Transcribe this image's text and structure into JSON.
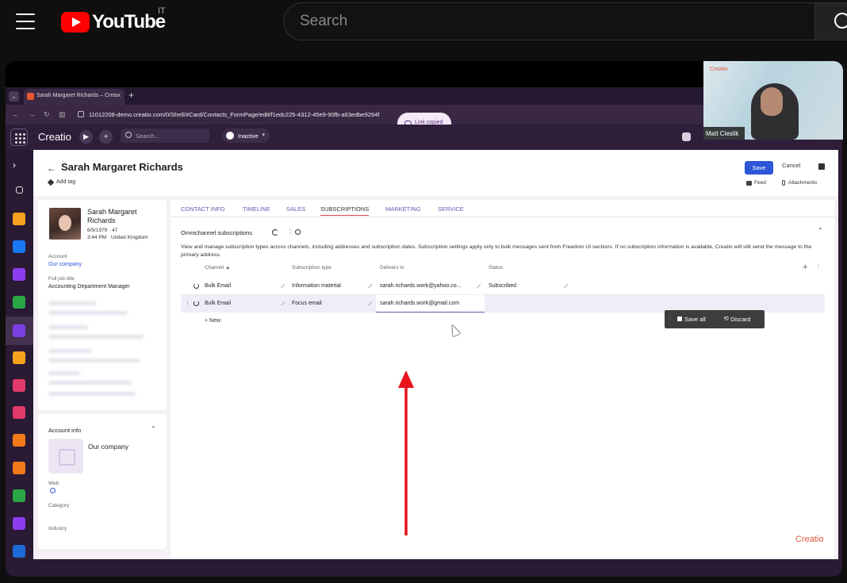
{
  "youtube": {
    "logo_text": "YouTube",
    "country_code": "IT",
    "search_placeholder": "Search"
  },
  "browser": {
    "tab_title": "Sarah Margaret Richards – Crea",
    "url": "11012208-demo.creatio.com/0/Shell/#Card/Contacts_FormPage/edit/f1edc225-4312-45e9-90fb-a63edbe9294f",
    "toast": "Link copied"
  },
  "creatio_bar": {
    "logo": "Creatio",
    "search_placeholder": "Search...",
    "status": "Inactive"
  },
  "header": {
    "title": "Sarah Margaret Richards",
    "add_tag": "Add tag",
    "save": "Save",
    "cancel": "Cancel",
    "feed": "Feed",
    "attachments": "Attachments"
  },
  "contact": {
    "name": "Sarah Margaret Richards",
    "dob": "6/5/1979 · 47",
    "time_location": "3:44 PM · United Kingdom",
    "account_label": "Account",
    "account_value": "Our company",
    "job_label": "Full job title",
    "job_value": "Accounting Department Manager"
  },
  "account_info": {
    "title": "Account info",
    "company": "Our company",
    "web_label": "Web",
    "category_label": "Category",
    "industry_label": "Industry"
  },
  "tabs": [
    "CONTACT INFO",
    "TIMELINE",
    "SALES",
    "SUBSCRIPTIONS",
    "MARKETING",
    "SERVICE"
  ],
  "subscriptions": {
    "title": "Omnichannel subscriptions",
    "description": "View and manage subscription types across channels, including addresses and subscription dates. Subscription settings apply only to bulk messages sent from Freedom UI sections. If no subscription information is available, Creatio will still send the message to the primary address.",
    "columns": [
      "Channel",
      "Subscription type",
      "Delivers to",
      "Status"
    ],
    "rows": [
      {
        "channel": "Bulk Email",
        "type": "Information material",
        "delivers_to": "sarah.richards.work@yahoo.co...",
        "status": "Subscribed"
      },
      {
        "channel": "Bulk Email",
        "type": "Focus email",
        "delivers_to": "sarah.richards.work@gmail.com",
        "status": ""
      }
    ],
    "new_label": "New",
    "save_all": "Save all",
    "discard": "Discard"
  },
  "watermark": "Creatio",
  "pip": {
    "logo": "Creatio",
    "name": "Matt Cieslik"
  },
  "colors": {
    "yt_red": "#ff0000",
    "creatio_primary": "#2c55d8",
    "annotation_arrow": "#e8141a",
    "tab_active_underline": "#e0484a"
  }
}
